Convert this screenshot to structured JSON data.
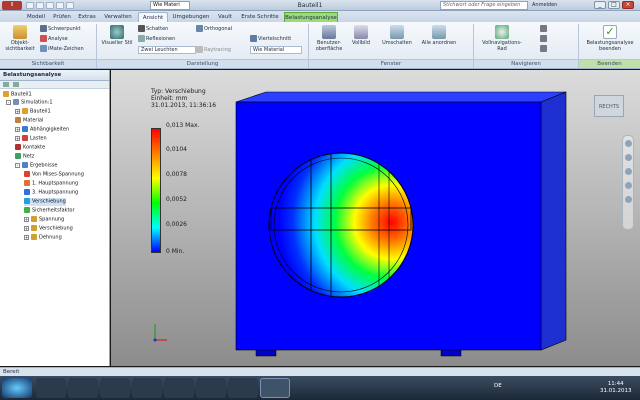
{
  "window": {
    "title": "Bauteil1",
    "material_combo": "Wie Materi",
    "search_placeholder": "Stichwort oder Frage eingeben",
    "login": "Anmelden",
    "controls": [
      "_",
      "□",
      "×"
    ]
  },
  "tabs": [
    "Modell",
    "Prüfen",
    "Extras",
    "Verwalten",
    "Ansicht",
    "Umgebungen",
    "Vault",
    "Erste Schritte",
    "Belastungsanalyse"
  ],
  "active_tab": "Ansicht",
  "ribbon": {
    "sichtbarkeit": {
      "title": "Sichtbarkeit",
      "big_button": "Objekt-\nsichtbarkeit",
      "items": [
        "Schwerpunkt",
        "Analyse",
        "iMate-Zeichen"
      ]
    },
    "darstellung": {
      "title": "Darstellung",
      "visual_style": "Visueller Stil",
      "schatten": "Schatten",
      "reflexionen": "Reflexionen",
      "zwei_leuchten": "Zwei Leuchten",
      "orthogonal": "Orthogonal",
      "raytracing": "Raytracing",
      "viertelschnitt": "Viertelschnitt",
      "wie_material": "Wie Material"
    },
    "fenster": {
      "title": "Fenster",
      "benutzeroberflaeche": "Benutzer-\noberfläche",
      "vollbild": "Vollbild",
      "umschalten": "Umschalten",
      "alle_anordnen": "Alle anordnen"
    },
    "navigieren": {
      "title": "Navigieren",
      "vollnavigationsrad": "Vollnavigations-\nRad"
    },
    "beenden": {
      "title": "Beenden",
      "button": "Belastungsanalyse\nbeenden"
    }
  },
  "browser": {
    "title": "Belastungsanalyse",
    "part": "Bauteil1",
    "tree": [
      {
        "label": "Simulation:1",
        "indent": 0,
        "expand": "-",
        "color": "#7a8fb0"
      },
      {
        "label": "Bauteil1",
        "indent": 1,
        "expand": "+",
        "color": "#e0a030"
      },
      {
        "label": "Material",
        "indent": 1,
        "expand": "",
        "color": "#c08040"
      },
      {
        "label": "Abhängigkeiten",
        "indent": 1,
        "expand": "+",
        "color": "#3a7dd0"
      },
      {
        "label": "Lasten",
        "indent": 1,
        "expand": "+",
        "color": "#d04040"
      },
      {
        "label": "Kontakte",
        "indent": 1,
        "expand": "",
        "color": "#b03030"
      },
      {
        "label": "Netz",
        "indent": 1,
        "expand": "",
        "color": "#40a060"
      },
      {
        "label": "Ergebnisse",
        "indent": 1,
        "expand": "-",
        "color": "#5080c0"
      },
      {
        "label": "Von Mises-Spannung",
        "indent": 2,
        "expand": "",
        "color": "#e04030"
      },
      {
        "label": "1. Hauptspannung",
        "indent": 2,
        "expand": "",
        "color": "#e07030"
      },
      {
        "label": "3. Hauptspannung",
        "indent": 2,
        "expand": "",
        "color": "#3070e0"
      },
      {
        "label": "Verschiebung",
        "indent": 2,
        "expand": "",
        "color": "#20a0e0",
        "selected": true
      },
      {
        "label": "Sicherheitsfaktor",
        "indent": 2,
        "expand": "",
        "color": "#40b040"
      },
      {
        "label": "Spannung",
        "indent": 2,
        "expand": "+",
        "color": "#d0a030"
      },
      {
        "label": "Verschiebung",
        "indent": 2,
        "expand": "+",
        "color": "#d0a030"
      },
      {
        "label": "Dehnung",
        "indent": 2,
        "expand": "+",
        "color": "#d0a030"
      }
    ]
  },
  "legend": {
    "type": "Typ: Verschiebung",
    "unit": "Einheit: mm",
    "date": "31.01.2013, 11:36:16",
    "values": [
      "0,013 Max.",
      "0,0104",
      "0,0078",
      "0,0052",
      "0,0026",
      "0 Min."
    ]
  },
  "viewcube_label": "RECHTS",
  "status": "Bereit",
  "taskbar": {
    "lang": "DE",
    "time": "11:44",
    "date": "31.01.2013"
  }
}
